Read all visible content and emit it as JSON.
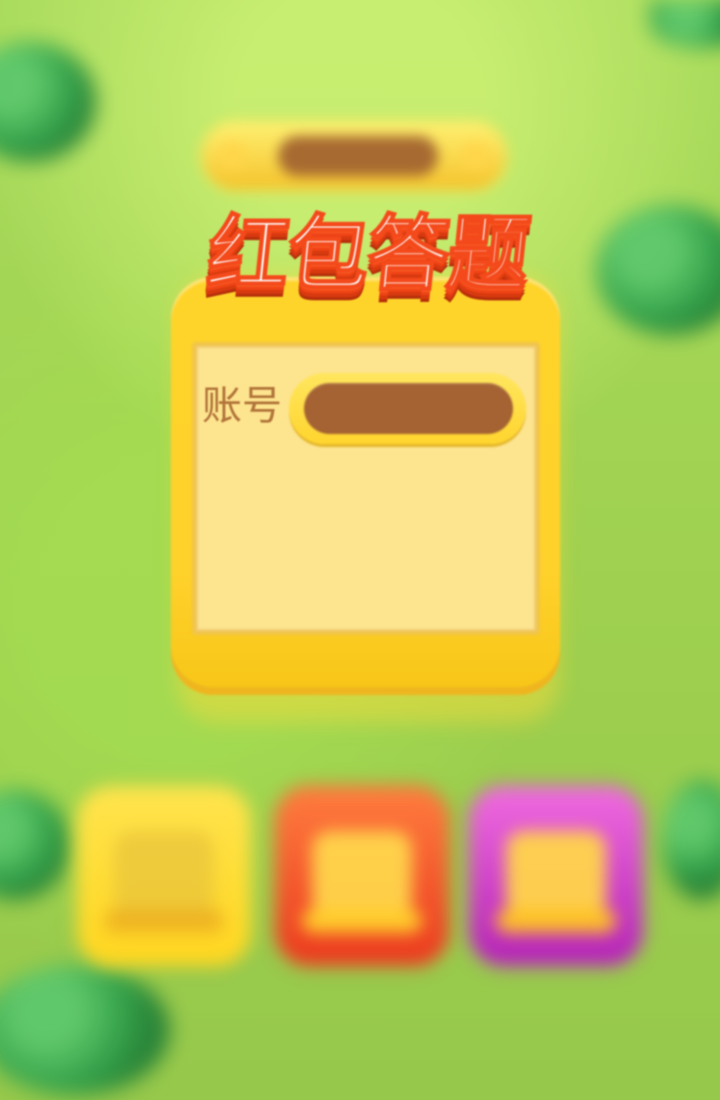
{
  "page": {
    "title": "红包答题"
  },
  "card": {
    "account_label": "账号"
  }
}
